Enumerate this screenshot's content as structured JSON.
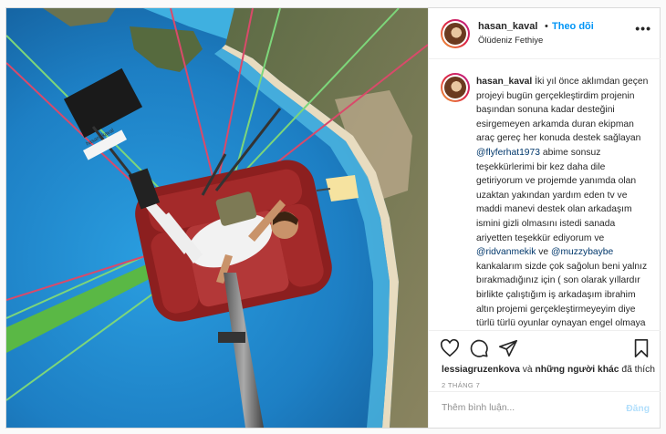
{
  "post": {
    "username": "hasan_kaval",
    "separator": "•",
    "follow_label": "Theo dõi",
    "location": "Ölüdeniz Fethiye",
    "more_label": "•••",
    "caption_username": "hasan_kaval",
    "caption_part1": " İki yıl önce aklımdan geçen projeyi bugün gerçekleştirdim projenin başından sonuna kadar desteğini esirgemeyen arkamda duran ekipman araç gereç her konuda destek sağlayan ",
    "mention_1": "@flyferhat1973",
    "caption_part2": " abime sonsuz teşekkürlerimi bir kez daha dile getiriyorum ve projemde yanımda olan uzaktan yakından yardım eden tv ve maddi manevi destek olan arkadaşım ismini gizli olmasını istedi sanada ariyetten teşekkür ediyorum ve ",
    "mention_2": "@ridvanmekik",
    "caption_part3": " ve ",
    "mention_3": "@muzzybaybe",
    "caption_part4": " kankalarım sizde çok sağolun beni yalnız bırakmadığınız için ( son olarak yıllardır birlikte çalıştığım iş arkadaşım ibrahim altın projemi gerçekleştirmeyeyim diye türlü türlü oyunlar oynayan engel olmaya çalışan",
    "likes_user": "lessiagruzenkova",
    "likes_and": " và ",
    "likes_others": "những người khác",
    "likes_suffix": " đã thích",
    "date": "2 THÁNG 7",
    "comment_placeholder": "Thêm bình luận...",
    "post_label": "Đăng",
    "photo_sticker": "hasan_kaval"
  },
  "colors": {
    "link": "#0095f6",
    "mention": "#00376b",
    "sea": "#1d7fc4",
    "post_disabled": "#b2dffc"
  },
  "icons": [
    "heart-icon",
    "comment-icon",
    "share-icon",
    "bookmark-icon",
    "more-icon"
  ]
}
